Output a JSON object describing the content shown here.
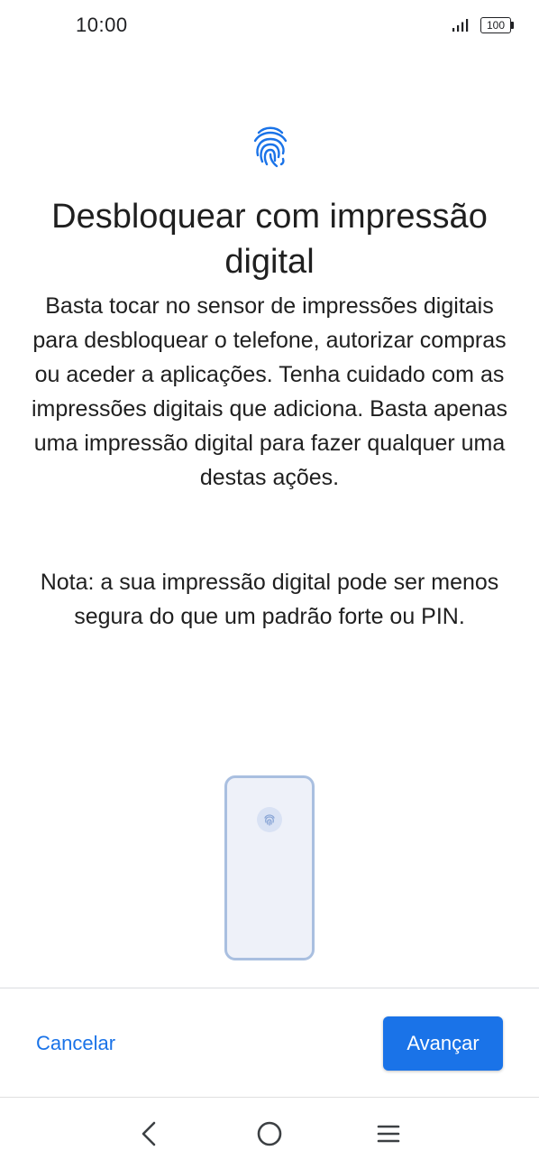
{
  "status_bar": {
    "time": "10:00",
    "battery_level": "100",
    "icons": [
      "signal-icon",
      "battery-icon"
    ]
  },
  "screen": {
    "header_icon": "fingerprint-icon",
    "title": "Desbloquear com impressão digital",
    "description": "Basta tocar no sensor de impressões digitais para desbloquear o telefone, autorizar compras ou aceder a aplicações. Tenha cuidado com as impressões digitais que adiciona. Basta apenas uma impressão digital para fazer qualquer uma destas ações.",
    "note": "Nota: a sua impressão digital pode ser menos segura do que um padrão forte ou PIN."
  },
  "illustration": {
    "icon": "phone-fingerprint-sensor-icon"
  },
  "actions": {
    "cancel_label": "Cancelar",
    "next_label": "Avançar"
  },
  "navigation": {
    "icons": [
      "back-icon",
      "home-icon",
      "menu-icon"
    ]
  },
  "colors": {
    "accent": "#1a73e8",
    "illustration_border": "#a9bfe0",
    "illustration_fill": "#eef1f9"
  }
}
